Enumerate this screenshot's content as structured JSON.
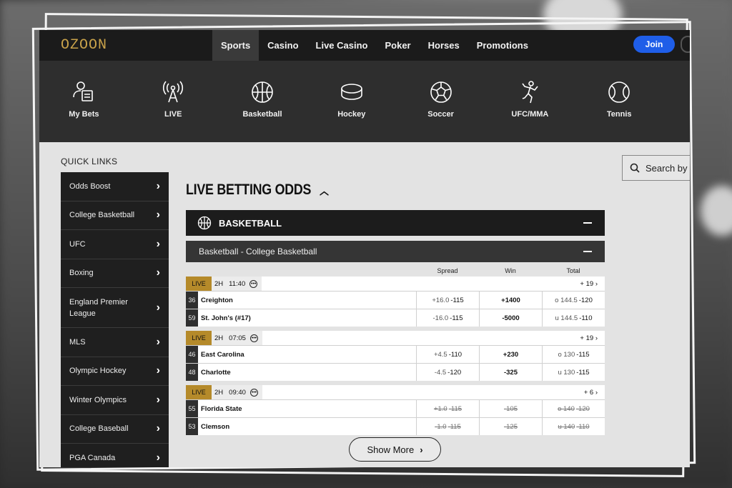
{
  "brand": {
    "logo": "OZOON",
    "gold": "#c9a24a",
    "join_blue": "#1f5ee8"
  },
  "nav": {
    "tabs": [
      "Sports",
      "Casino",
      "Live Casino",
      "Poker",
      "Horses",
      "Promotions"
    ],
    "active": "Sports",
    "join_label": "Join"
  },
  "sports": [
    {
      "label": "My Bets",
      "icon": "my-bets-icon"
    },
    {
      "label": "LIVE",
      "icon": "live-broadcast-icon"
    },
    {
      "label": "Basketball",
      "icon": "basketball-icon"
    },
    {
      "label": "Hockey",
      "icon": "hockey-puck-icon"
    },
    {
      "label": "Soccer",
      "icon": "soccer-ball-icon"
    },
    {
      "label": "UFC/MMA",
      "icon": "fighter-icon"
    },
    {
      "label": "Tennis",
      "icon": "tennis-ball-icon"
    }
  ],
  "quick_links": {
    "title": "QUICK LINKS",
    "items": [
      "Odds Boost",
      "College Basketball",
      "UFC",
      "Boxing",
      "England Premier League",
      "MLS",
      "Olympic Hockey",
      "Winter Olympics",
      "College Baseball",
      "PGA Canada"
    ]
  },
  "search": {
    "placeholder": "Search by s"
  },
  "live_betting": {
    "title": "LIVE BETTING ODDS",
    "sport_bar": "BASKETBALL",
    "league_bar": "Basketball - College Basketball",
    "columns": [
      "Spread",
      "Win",
      "Total"
    ],
    "games": [
      {
        "status": "LIVE",
        "period": "2H",
        "clock": "11:40",
        "more": "+ 19",
        "teams": [
          {
            "seed": "36",
            "name": "Creighton",
            "spread": "+16.0",
            "spread_price": "-115",
            "win": "+1400",
            "total": "o 144.5",
            "total_price": "-120"
          },
          {
            "seed": "59",
            "name": "St. John's (#17)",
            "spread": "-16.0",
            "spread_price": "-115",
            "win": "-5000",
            "total": "u 144.5",
            "total_price": "-110"
          }
        ],
        "suspended": false
      },
      {
        "status": "LIVE",
        "period": "2H",
        "clock": "07:05",
        "more": "+ 19",
        "teams": [
          {
            "seed": "46",
            "name": "East Carolina",
            "spread": "+4.5",
            "spread_price": "-110",
            "win": "+230",
            "total": "o 130",
            "total_price": "-115"
          },
          {
            "seed": "48",
            "name": "Charlotte",
            "spread": "-4.5",
            "spread_price": "-120",
            "win": "-325",
            "total": "u 130",
            "total_price": "-115"
          }
        ],
        "suspended": false
      },
      {
        "status": "LIVE",
        "period": "2H",
        "clock": "09:40",
        "more": "+ 6",
        "teams": [
          {
            "seed": "55",
            "name": "Florida State",
            "spread": "+1.0",
            "spread_price": "-115",
            "win": "-105",
            "total": "o 140",
            "total_price": "-120"
          },
          {
            "seed": "53",
            "name": "Clemson",
            "spread": "-1.0",
            "spread_price": "-115",
            "win": "-125",
            "total": "u 140",
            "total_price": "-110"
          }
        ],
        "suspended": true
      }
    ],
    "show_more": "Show More"
  }
}
